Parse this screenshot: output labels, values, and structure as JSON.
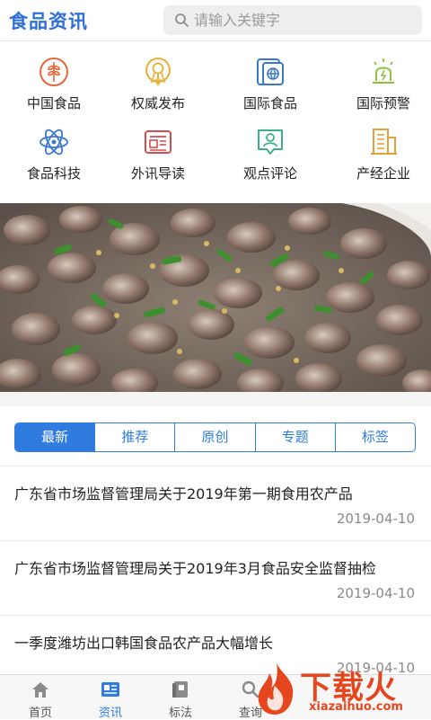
{
  "header": {
    "logo": "食品资讯",
    "search_placeholder": "请输入关键字"
  },
  "categories": [
    {
      "label": "中国食品",
      "icon": "grain-icon",
      "color": "#e5673a"
    },
    {
      "label": "权威发布",
      "icon": "medal-icon",
      "color": "#e5b13a"
    },
    {
      "label": "国际食品",
      "icon": "globe-icon",
      "color": "#3a79c9"
    },
    {
      "label": "国际预警",
      "icon": "alert-light-icon",
      "color": "#8cc43c"
    },
    {
      "label": "食品科技",
      "icon": "atom-icon",
      "color": "#3a79c9"
    },
    {
      "label": "外讯导读",
      "icon": "newspaper-icon",
      "color": "#d94c4c"
    },
    {
      "label": "观点评论",
      "icon": "comment-person-icon",
      "color": "#3fae8a"
    },
    {
      "label": "产经企业",
      "icon": "building-icon",
      "color": "#e5a13a"
    }
  ],
  "tabs": [
    "最新",
    "推荐",
    "原创",
    "专题",
    "标签"
  ],
  "news": [
    {
      "title": "广东省市场监督管理局关于2019年第一期食用农产品",
      "date": "2019-04-10"
    },
    {
      "title": "广东省市场监督管理局关于2019年3月食品安全监督抽检",
      "date": "2019-04-10"
    },
    {
      "title": "一季度潍坊出口韩国食品农产品大幅增长",
      "date": "2019-04-10"
    }
  ],
  "bottom_nav": [
    {
      "label": "首页",
      "icon": "home-icon"
    },
    {
      "label": "资讯",
      "icon": "news-card-icon"
    },
    {
      "label": "标法",
      "icon": "book-icon"
    },
    {
      "label": "查询",
      "icon": "search-icon"
    }
  ],
  "watermark": {
    "text": "下载火",
    "url": "xiazaihuo.com"
  },
  "colors": {
    "accent": "#2f7be0",
    "logo": "#2f6fd8",
    "watermark": "#e6461e"
  }
}
